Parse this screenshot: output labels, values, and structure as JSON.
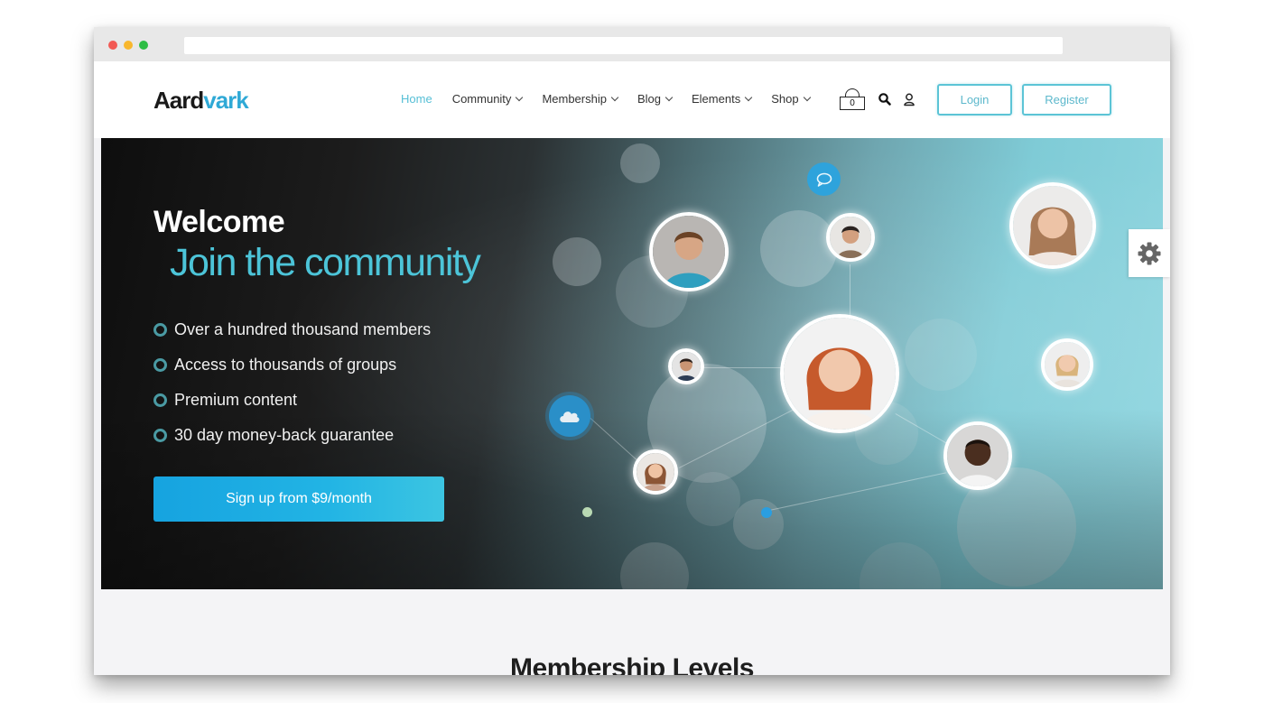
{
  "browser": {
    "traffic_lights": [
      "close",
      "minimize",
      "maximize"
    ],
    "url": ""
  },
  "header": {
    "logo_primary": "Aard",
    "logo_accent": "vark",
    "nav": [
      {
        "label": "Home",
        "active": true,
        "dropdown": false
      },
      {
        "label": "Community",
        "active": false,
        "dropdown": true
      },
      {
        "label": "Membership",
        "active": false,
        "dropdown": true
      },
      {
        "label": "Blog",
        "active": false,
        "dropdown": true
      },
      {
        "label": "Elements",
        "active": false,
        "dropdown": true
      },
      {
        "label": "Shop",
        "active": false,
        "dropdown": true
      }
    ],
    "cart_count": "0",
    "icons": [
      "cart-icon",
      "search-icon",
      "user-icon"
    ],
    "login_label": "Login",
    "register_label": "Register"
  },
  "hero": {
    "title": "Welcome",
    "subtitle": "Join the community",
    "features": [
      "Over a hundred thousand members",
      "Access to thousands of groups",
      "Premium content",
      "30 day money-back guarantee"
    ],
    "cta_label": "Sign up from $9/month",
    "node_icons": [
      "chat-bubble-icon",
      "cloud-icon"
    ]
  },
  "settings": {
    "icon": "gear-icon"
  },
  "section": {
    "title": "Membership Levels"
  },
  "colors": {
    "accent": "#4cc4d8",
    "cta": "#1fa9e1",
    "outline_button": "#5cc4d6",
    "logo_accent": "#2fa9d6"
  }
}
